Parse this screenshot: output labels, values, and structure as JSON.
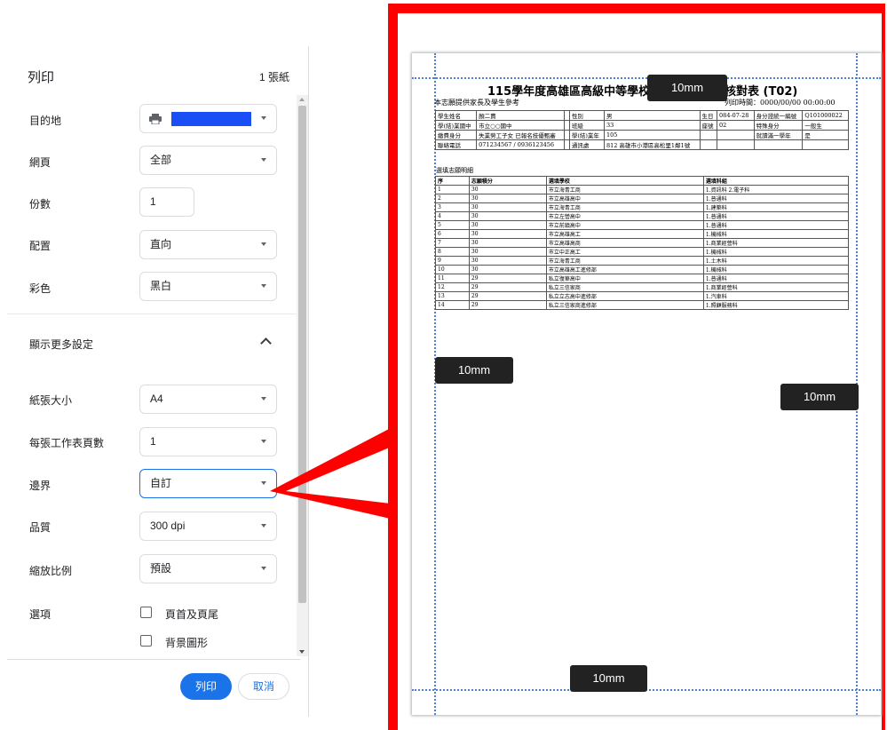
{
  "panel": {
    "title": "列印",
    "sheet_count": "1 張紙",
    "destination": {
      "label": "目的地",
      "value": ""
    },
    "pages": {
      "label": "網頁",
      "value": "全部"
    },
    "copies": {
      "label": "份數",
      "value": "1"
    },
    "layout": {
      "label": "配置",
      "value": "直向"
    },
    "color": {
      "label": "彩色",
      "value": "黑白"
    },
    "more_settings": "顯示更多設定",
    "paper_size": {
      "label": "紙張大小",
      "value": "A4"
    },
    "pages_per_sheet": {
      "label": "每張工作表頁數",
      "value": "1"
    },
    "margins": {
      "label": "邊界",
      "value": "自訂"
    },
    "quality": {
      "label": "品質",
      "value": "300 dpi"
    },
    "scale": {
      "label": "縮放比例",
      "value": "預設"
    },
    "options": {
      "label": "選項",
      "headers_footers": "頁首及頁尾",
      "background_graphics": "背景圖形"
    },
    "print_button": "列印",
    "cancel_button": "取消"
  },
  "preview": {
    "margin_tags": {
      "top": "10mm",
      "left": "10mm",
      "right": "10mm",
      "bottom": "10mm"
    },
    "doc": {
      "title": "115學年度高雄區高級中等學校免",
      "title_suffix": "核對表 (T02)",
      "note": "本志願提供家長及學生參考",
      "print_time": "列印時間：0000/00/00 00:00:00",
      "info_rows": [
        [
          "學生姓名",
          "顏二賣",
          "",
          "性別",
          "男",
          "生日",
          "084-07-28",
          "身分證統一編號",
          "Q101000022"
        ],
        [
          "學(結)業國中",
          "市立○○國中",
          "",
          "班級",
          "33",
          "座號",
          "02",
          "特殊身分",
          "一般生"
        ],
        [
          "繳費身分",
          "失業勞工子女 已報名技優甄審",
          "",
          "學(結)業年",
          "105",
          "",
          "",
          "就讀滿一學年",
          "是"
        ],
        [
          "聯絡電話",
          "071234567 / 0936123456",
          "",
          "通訊處",
          "812 高雄市小港區高松里1鄰1號",
          "",
          "",
          "",
          ""
        ]
      ],
      "wish_caption": "選填志願明細",
      "wish_headers": [
        "序",
        "志願積分",
        "選填學校",
        "選填科組"
      ],
      "wish_rows": [
        [
          "1",
          "30",
          "市立海青工商",
          "1.資訊科 2.電子科"
        ],
        [
          "2",
          "30",
          "市立高雄高中",
          "1.普通科"
        ],
        [
          "3",
          "30",
          "市立海青工商",
          "1.建築科"
        ],
        [
          "4",
          "30",
          "市立左營高中",
          "1.普通科"
        ],
        [
          "5",
          "30",
          "市立前鎮高中",
          "1.普通科"
        ],
        [
          "6",
          "30",
          "市立高雄高工",
          "1.機械科"
        ],
        [
          "7",
          "30",
          "市立高雄高商",
          "1.商業經營科"
        ],
        [
          "8",
          "30",
          "市立中正高工",
          "1.機械科"
        ],
        [
          "9",
          "30",
          "市立海青工商",
          "1.土木科"
        ],
        [
          "10",
          "30",
          "市立高雄高工進修部",
          "1.機械科"
        ],
        [
          "11",
          "29",
          "私立復華高中",
          "1.普通科"
        ],
        [
          "12",
          "29",
          "私立三信家商",
          "1.商業經營科"
        ],
        [
          "13",
          "29",
          "私立立志高中進修部",
          "1.汽車科"
        ],
        [
          "14",
          "29",
          "私立三信家商進修部",
          "1.照顧服務科"
        ]
      ]
    }
  },
  "colors": {
    "accent": "#1a73e8",
    "highlight_frame": "#ff0000",
    "margin_guides": "#4a7fe0"
  }
}
